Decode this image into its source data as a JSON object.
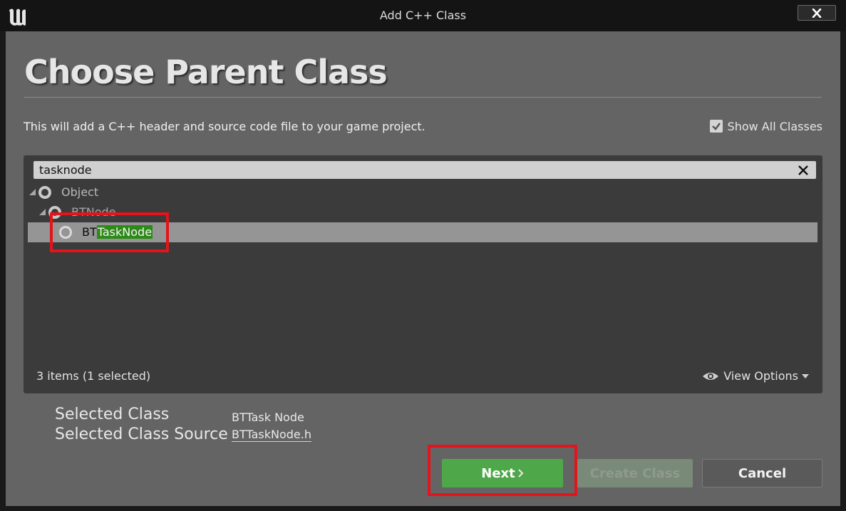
{
  "window": {
    "title": "Add C++ Class"
  },
  "heading": "Choose Parent Class",
  "description": "This will add a C++ header and source code file to your game project.",
  "show_all_classes": {
    "label": "Show All Classes",
    "checked": true
  },
  "search": {
    "value": "tasknode"
  },
  "tree": {
    "items": [
      {
        "label": "Object",
        "depth": 0
      },
      {
        "label": "BTNode",
        "depth": 1
      },
      {
        "label_prefix": "BT",
        "label_match": "TaskNode",
        "depth": 2,
        "selected": true
      }
    ]
  },
  "status": {
    "count_text": "3 items (1 selected)",
    "view_options": "View Options"
  },
  "selected_info": {
    "class_label": "Selected Class",
    "class_value": "BTTask Node",
    "source_label": "Selected Class Source",
    "source_value": "BTTaskNode.h"
  },
  "buttons": {
    "next": "Next",
    "create": "Create Class",
    "cancel": "Cancel"
  },
  "colors": {
    "highlight": "#2c8a17",
    "next_button": "#4ea84a",
    "annotation_red": "#e3141b"
  },
  "icons": {
    "app_logo": "unreal-logo-icon",
    "close": "close-icon",
    "clear": "clear-x-icon",
    "tree_node": "circle-class-icon",
    "expand": "expanded-triangle-icon",
    "eye": "eye-icon",
    "chevron": "chevron-right-icon",
    "dropdown": "dropdown-triangle-icon"
  }
}
